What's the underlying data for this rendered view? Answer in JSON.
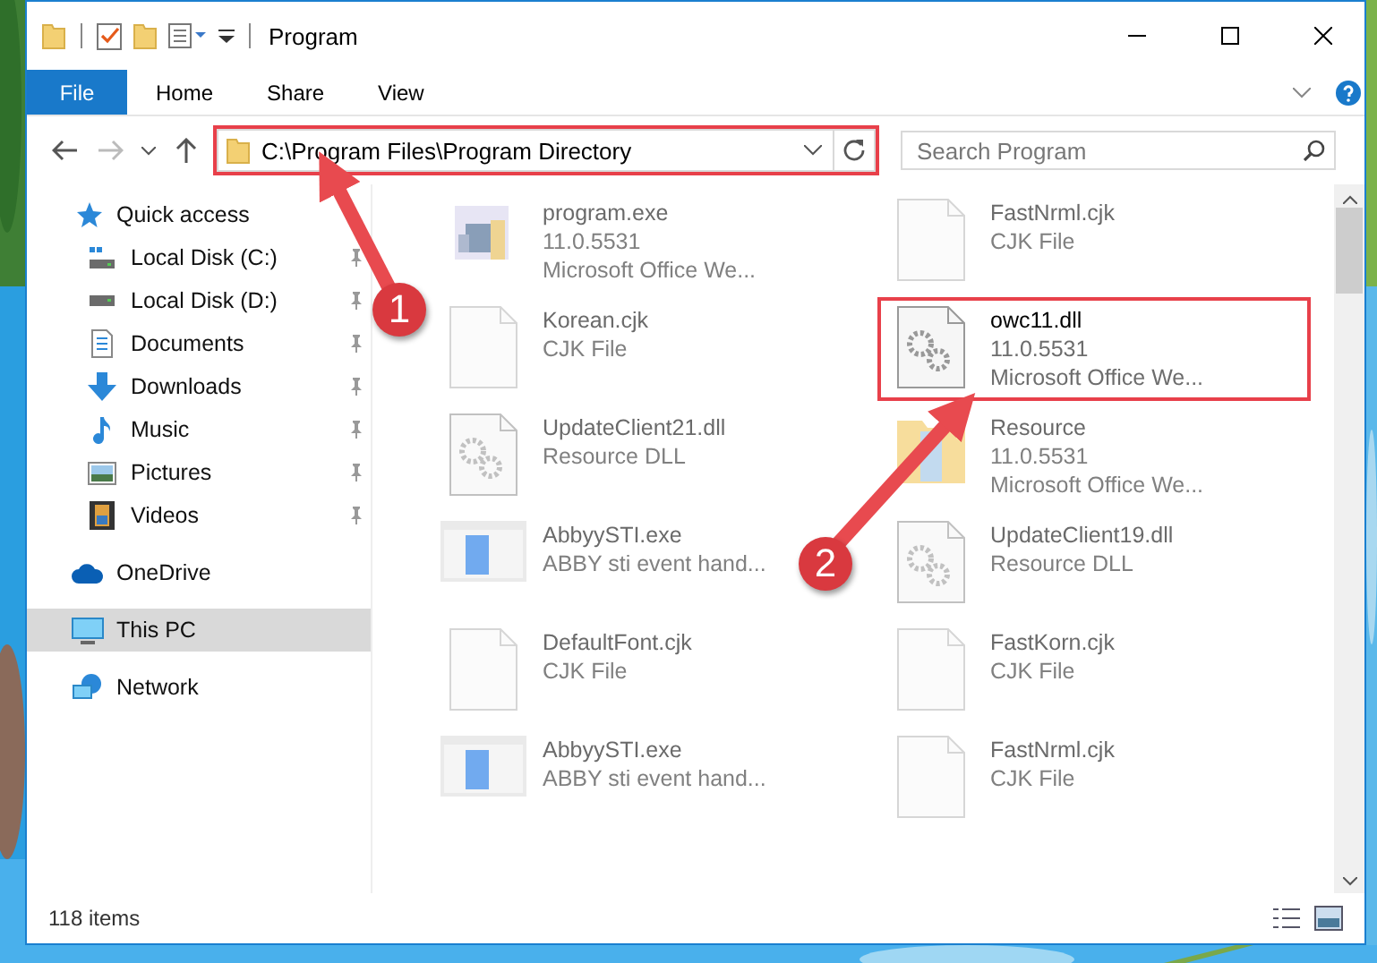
{
  "window": {
    "title": "Program"
  },
  "ribbon_tabs": [
    {
      "label": "File",
      "kind": "file"
    },
    {
      "label": "Home",
      "kind": "plain"
    },
    {
      "label": "Share",
      "kind": "plain"
    },
    {
      "label": "View",
      "kind": "plain"
    }
  ],
  "address_bar": {
    "path": "C:\\Program Files\\Program Directory",
    "highlighted": true
  },
  "search": {
    "placeholder": "Search Program"
  },
  "sidebar": {
    "items": [
      {
        "label": "Quick access",
        "kind": "star",
        "selected": false,
        "children": [
          {
            "label": "Local Disk (C:)",
            "kind": "disk-c",
            "pinned": true,
            "selected": false
          },
          {
            "label": "Local Disk (D:)",
            "kind": "disk",
            "pinned": true,
            "selected": false
          },
          {
            "label": "Documents",
            "kind": "doc",
            "pinned": true,
            "selected": false
          },
          {
            "label": "Downloads",
            "kind": "download",
            "pinned": true,
            "selected": false
          },
          {
            "label": "Music",
            "kind": "music",
            "pinned": true,
            "selected": false
          },
          {
            "label": "Pictures",
            "kind": "pictures",
            "pinned": true,
            "selected": false
          },
          {
            "label": "Videos",
            "kind": "videos",
            "pinned": true,
            "selected": false
          }
        ]
      },
      {
        "label": "OneDrive",
        "kind": "cloud",
        "selected": false
      },
      {
        "label": "This PC",
        "kind": "pc",
        "selected": true
      },
      {
        "label": "Network",
        "kind": "network",
        "selected": false
      }
    ]
  },
  "files": [
    {
      "name": "program.exe",
      "details": [
        "11.0.5531",
        "Microsoft Office We..."
      ],
      "kind": "exe",
      "highlighted": false,
      "blurred": true
    },
    {
      "name": "FastNrml.cjk",
      "details": [
        "CJK File"
      ],
      "kind": "blank",
      "highlighted": false,
      "blurred": true
    },
    {
      "name": "Korean.cjk",
      "details": [
        "CJK File"
      ],
      "kind": "blank",
      "highlighted": false,
      "blurred": true
    },
    {
      "name": "owc11.dll",
      "details": [
        "11.0.5531",
        "Microsoft Office We..."
      ],
      "kind": "dll",
      "highlighted": true,
      "blurred": false
    },
    {
      "name": "UpdateClient21.dll",
      "details": [
        "Resource DLL"
      ],
      "kind": "dll",
      "highlighted": false,
      "blurred": true
    },
    {
      "name": "Resource",
      "details": [
        "11.0.5531",
        "Microsoft Office We..."
      ],
      "kind": "folder",
      "highlighted": false,
      "blurred": true
    },
    {
      "name": "AbbyySTI.exe",
      "details": [
        "ABBY sti event hand..."
      ],
      "kind": "app",
      "highlighted": false,
      "blurred": true
    },
    {
      "name": "UpdateClient19.dll",
      "details": [
        "Resource DLL"
      ],
      "kind": "dll",
      "highlighted": false,
      "blurred": true
    },
    {
      "name": "DefaultFont.cjk",
      "details": [
        "CJK File"
      ],
      "kind": "blank",
      "highlighted": false,
      "blurred": true
    },
    {
      "name": "FastKorn.cjk",
      "details": [
        "CJK File"
      ],
      "kind": "blank",
      "highlighted": false,
      "blurred": true
    },
    {
      "name": "AbbyySTI.exe",
      "details": [
        "ABBY sti event hand..."
      ],
      "kind": "app",
      "highlighted": false,
      "blurred": true
    },
    {
      "name": "FastNrml.cjk",
      "details": [
        "CJK File"
      ],
      "kind": "blank",
      "highlighted": false,
      "blurred": true
    }
  ],
  "status_bar": {
    "count": "118 items"
  },
  "annotations": [
    {
      "number": "1"
    },
    {
      "number": "2"
    }
  ]
}
